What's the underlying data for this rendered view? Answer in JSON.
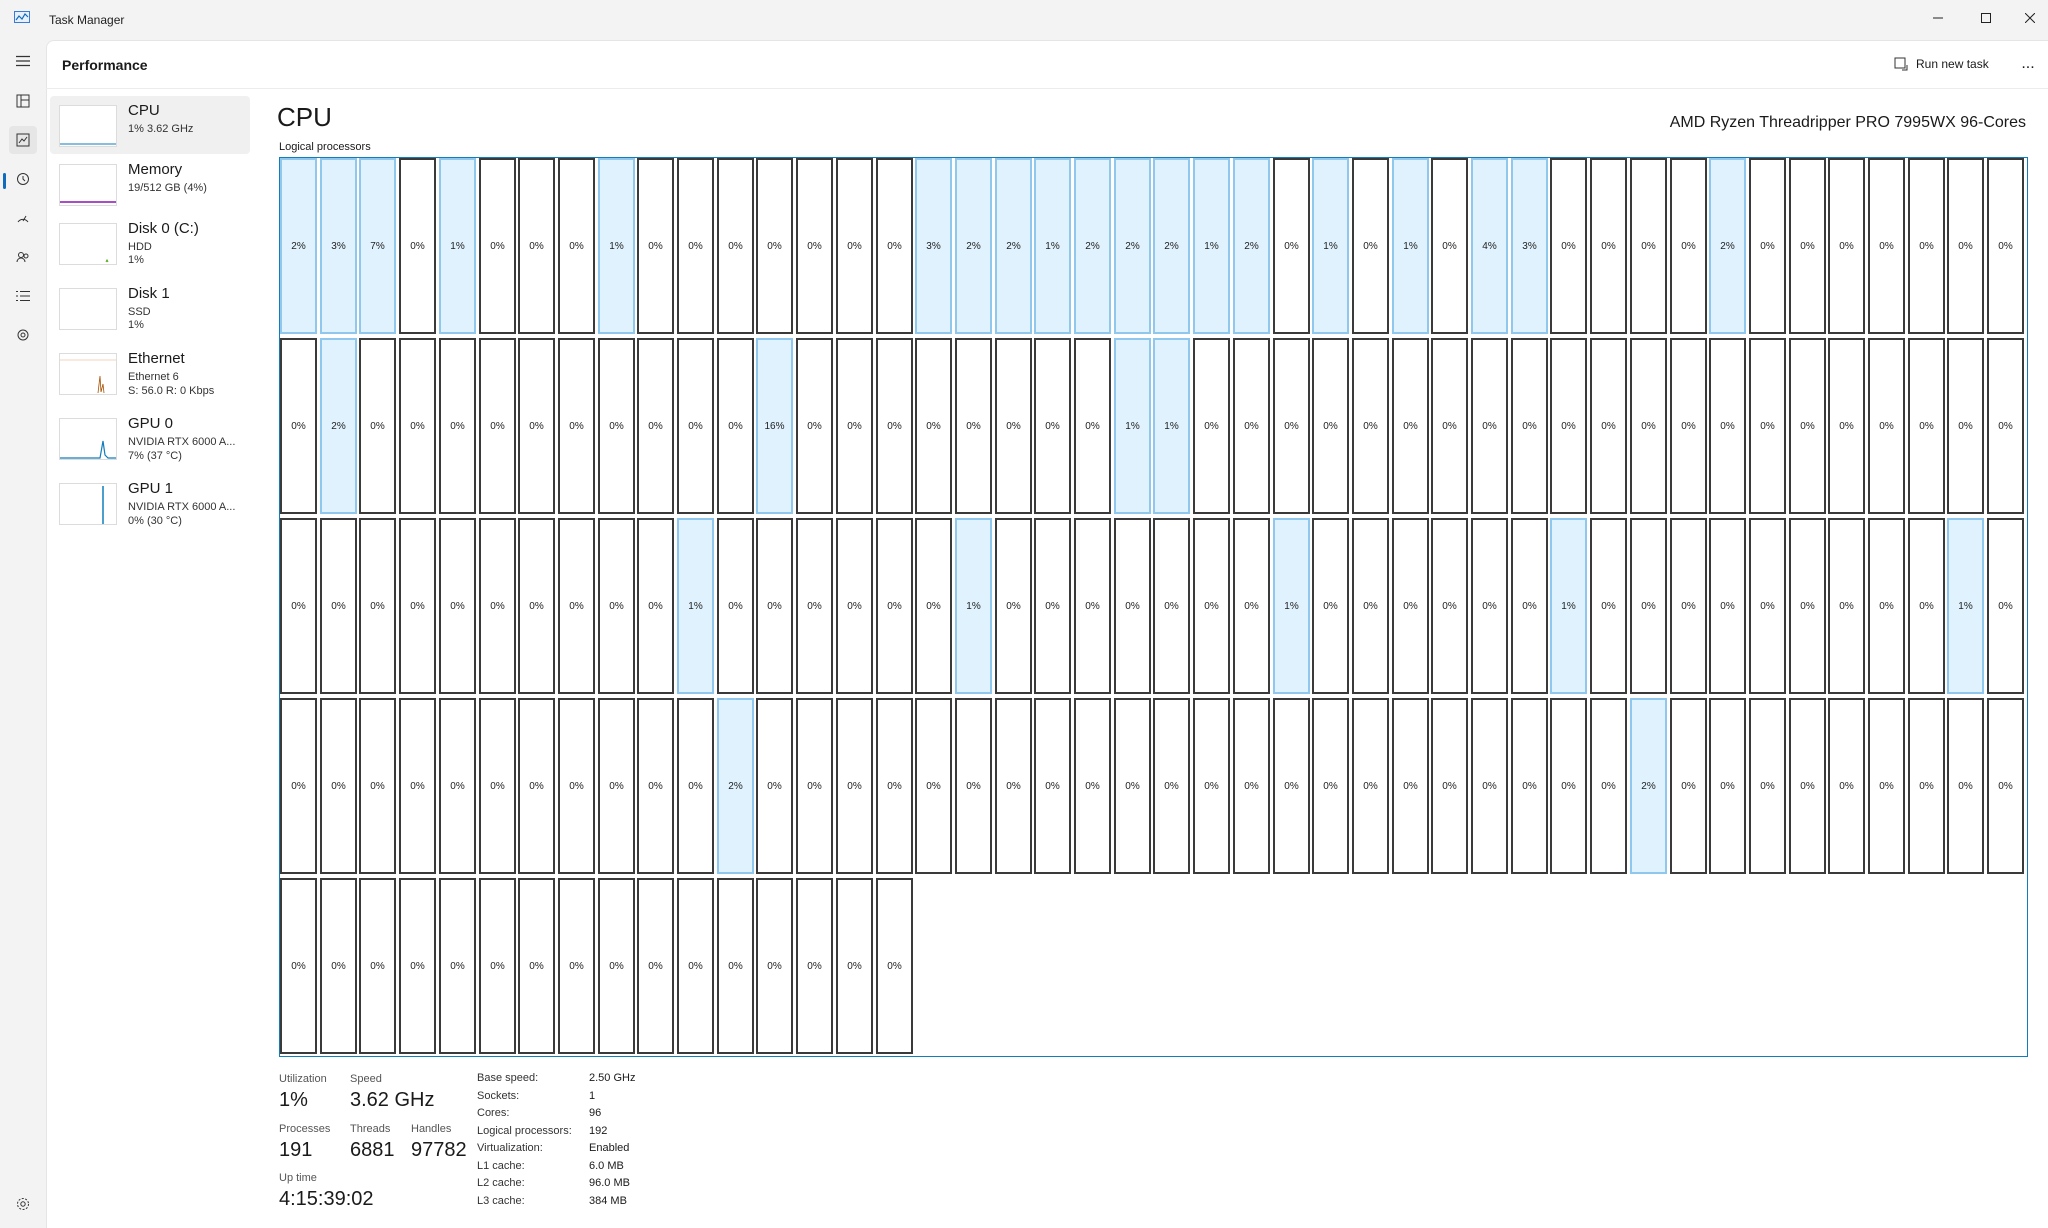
{
  "window": {
    "title": "Task Manager"
  },
  "header": {
    "title": "Performance",
    "run_task_label": "Run new task",
    "more_label": "..."
  },
  "rail": {
    "items": [
      "hamburger-icon",
      "processes-icon",
      "performance-icon",
      "app-history-icon",
      "startup-apps-icon",
      "users-icon",
      "details-icon",
      "services-icon"
    ],
    "active": "performance-icon"
  },
  "sidebar": {
    "items": [
      {
        "name": "CPU",
        "sub": [
          "1%  3.62 GHz"
        ],
        "active": true
      },
      {
        "name": "Memory",
        "sub": [
          "19/512 GB (4%)"
        ]
      },
      {
        "name": "Disk 0 (C:)",
        "sub": [
          "HDD",
          "1%"
        ]
      },
      {
        "name": "Disk 1",
        "sub": [
          "SSD",
          "1%"
        ]
      },
      {
        "name": "Ethernet",
        "sub": [
          "Ethernet 6",
          "S: 56.0  R: 0 Kbps"
        ]
      },
      {
        "name": "GPU 0",
        "sub": [
          "NVIDIA RTX 6000 A...",
          "7% (37 °C)"
        ]
      },
      {
        "name": "GPU 1",
        "sub": [
          "NVIDIA RTX 6000 A...",
          "0% (30 °C)"
        ]
      }
    ]
  },
  "main": {
    "title": "CPU",
    "model": "AMD Ryzen Threadripper PRO 7995WX 96-Cores",
    "grid_label": "Logical processors"
  },
  "processors": [
    "2%",
    "3%",
    "7%",
    "0%",
    "1%",
    "0%",
    "0%",
    "0%",
    "1%",
    "0%",
    "0%",
    "0%",
    "0%",
    "0%",
    "0%",
    "0%",
    "3%",
    "2%",
    "2%",
    "1%",
    "2%",
    "2%",
    "2%",
    "1%",
    "2%",
    "0%",
    "1%",
    "0%",
    "1%",
    "0%",
    "4%",
    "3%",
    "0%",
    "0%",
    "0%",
    "0%",
    "2%",
    "0%",
    "0%",
    "0%",
    "0%",
    "0%",
    "0%",
    "0%",
    "0%",
    "2%",
    "0%",
    "0%",
    "0%",
    "0%",
    "0%",
    "0%",
    "0%",
    "0%",
    "0%",
    "0%",
    "16%",
    "0%",
    "0%",
    "0%",
    "0%",
    "0%",
    "0%",
    "0%",
    "0%",
    "1%",
    "1%",
    "0%",
    "0%",
    "0%",
    "0%",
    "0%",
    "0%",
    "0%",
    "0%",
    "0%",
    "0%",
    "0%",
    "0%",
    "0%",
    "0%",
    "0%",
    "0%",
    "0%",
    "0%",
    "0%",
    "0%",
    "0%",
    "0%",
    "0%",
    "0%",
    "0%",
    "0%",
    "0%",
    "0%",
    "0%",
    "0%",
    "0%",
    "1%",
    "0%",
    "0%",
    "0%",
    "0%",
    "0%",
    "0%",
    "1%",
    "0%",
    "0%",
    "0%",
    "0%",
    "0%",
    "0%",
    "0%",
    "1%",
    "0%",
    "0%",
    "0%",
    "0%",
    "0%",
    "0%",
    "1%",
    "0%",
    "0%",
    "0%",
    "0%",
    "0%",
    "0%",
    "0%",
    "0%",
    "0%",
    "1%",
    "0%",
    "0%",
    "0%",
    "0%",
    "0%",
    "0%",
    "0%",
    "0%",
    "0%",
    "0%",
    "0%",
    "0%",
    "2%",
    "0%",
    "0%",
    "0%",
    "0%",
    "0%",
    "0%",
    "0%",
    "0%",
    "0%",
    "0%",
    "0%",
    "0%",
    "0%",
    "0%",
    "0%",
    "0%",
    "0%",
    "0%",
    "0%",
    "0%",
    "0%",
    "0%",
    "2%",
    "0%",
    "0%",
    "0%",
    "0%",
    "0%",
    "0%",
    "0%",
    "0%",
    "0%",
    "0%",
    "0%",
    "0%",
    "0%",
    "0%",
    "0%",
    "0%",
    "0%",
    "0%",
    "0%",
    "0%",
    "0%",
    "0%",
    "0%",
    "0%",
    "0%"
  ],
  "stats": {
    "utilization_label": "Utilization",
    "utilization": "1%",
    "speed_label": "Speed",
    "speed": "3.62 GHz",
    "processes_label": "Processes",
    "processes": "191",
    "threads_label": "Threads",
    "threads": "6881",
    "handles_label": "Handles",
    "handles": "97782",
    "uptime_label": "Up time",
    "uptime": "4:15:39:02"
  },
  "specs": [
    {
      "label": "Base speed:",
      "value": "2.50 GHz"
    },
    {
      "label": "Sockets:",
      "value": "1"
    },
    {
      "label": "Cores:",
      "value": "96"
    },
    {
      "label": "Logical processors:",
      "value": "192"
    },
    {
      "label": "Virtualization:",
      "value": "Enabled"
    },
    {
      "label": "L1 cache:",
      "value": "6.0 MB"
    },
    {
      "label": "L2 cache:",
      "value": "96.0 MB"
    },
    {
      "label": "L3 cache:",
      "value": "384 MB"
    }
  ],
  "colors": {
    "accent": "#0f6cbd",
    "cpu_graph": "#117dbb",
    "cell_fill": "#e0f2fd",
    "memory": "#8b12ae",
    "ethernet": "#a74f01",
    "disk": "#4da60c"
  }
}
